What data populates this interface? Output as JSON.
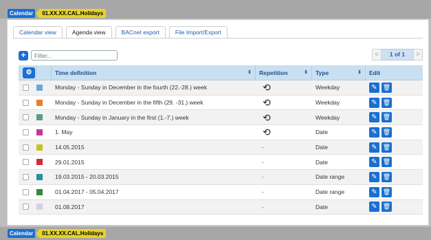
{
  "breadcrumb": {
    "root": "Calendar",
    "object": "01.XX.XX.CAL.Holidays"
  },
  "tabs": [
    {
      "label": "Calendar view",
      "active": false
    },
    {
      "label": "Agenda view",
      "active": true
    },
    {
      "label": "BACnet export",
      "active": false
    },
    {
      "label": "File Import/Export",
      "active": false
    }
  ],
  "toolbar": {
    "filter_placeholder": "Filter...",
    "page_label": "1 of 1",
    "prev_glyph": "<",
    "next_glyph": ">"
  },
  "table": {
    "headers": {
      "time_definition": "Time definition",
      "repetition": "Repetition",
      "type": "Type",
      "edit": "Edit"
    },
    "rows": [
      {
        "color": "#6aa8d8",
        "time": "Monday - Sunday in December in the fourth (22.-28.) week",
        "repeat": true,
        "type": "Weekday"
      },
      {
        "color": "#f07a2a",
        "time": "Monday - Sunday in December in the fifth (29. -31.) week",
        "repeat": true,
        "type": "Weekday"
      },
      {
        "color": "#5f9a86",
        "time": "Monday - Sunday in January in the first (1.-7.) week",
        "repeat": true,
        "type": "Weekday"
      },
      {
        "color": "#c2389a",
        "time": "1. May",
        "repeat": true,
        "type": "Date"
      },
      {
        "color": "#c3c41a",
        "time": "14.05.2015",
        "repeat": false,
        "type": "Date"
      },
      {
        "color": "#d42a3c",
        "time": "29.01.2015",
        "repeat": false,
        "type": "Date"
      },
      {
        "color": "#1e92a0",
        "time": "19.03.2015 - 20.03.2015",
        "repeat": false,
        "type": "Date range"
      },
      {
        "color": "#2f8a3c",
        "time": "01.04.2017 - 05.04.2017",
        "repeat": false,
        "type": "Date range"
      },
      {
        "color": "#d8cde8",
        "time": "01.08.2017",
        "repeat": false,
        "type": "Date"
      }
    ]
  },
  "icons": {
    "add": "plus-icon",
    "settings": "settings-icon",
    "repeat": "repeat-icon",
    "edit": "pencil-icon",
    "delete": "trash-icon"
  }
}
